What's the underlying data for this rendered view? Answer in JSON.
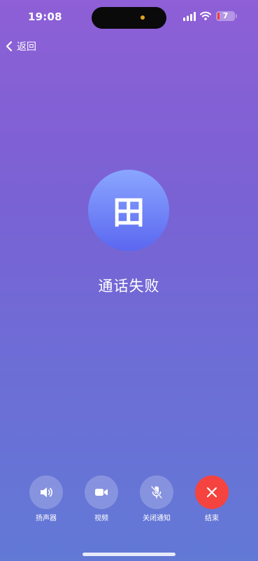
{
  "status_bar": {
    "time": "19:08",
    "battery": "7",
    "icons": [
      "moon-icon",
      "signal-icon",
      "wifi-icon",
      "battery-icon"
    ]
  },
  "nav": {
    "back_label": "返回",
    "back_icon": "chevron-left-icon"
  },
  "contact": {
    "avatar_text": "田",
    "status": "通话失败"
  },
  "controls": [
    {
      "label": "扬声器",
      "icon": "speaker-icon"
    },
    {
      "label": "视频",
      "icon": "video-camera-icon"
    },
    {
      "label": "关闭通知",
      "icon": "mic-muted-icon"
    },
    {
      "label": "结束",
      "icon": "close-icon"
    }
  ],
  "colors": {
    "end_call": "#f5433f",
    "battery_low": "#ff3b30",
    "island_dot": "#e0a520"
  }
}
